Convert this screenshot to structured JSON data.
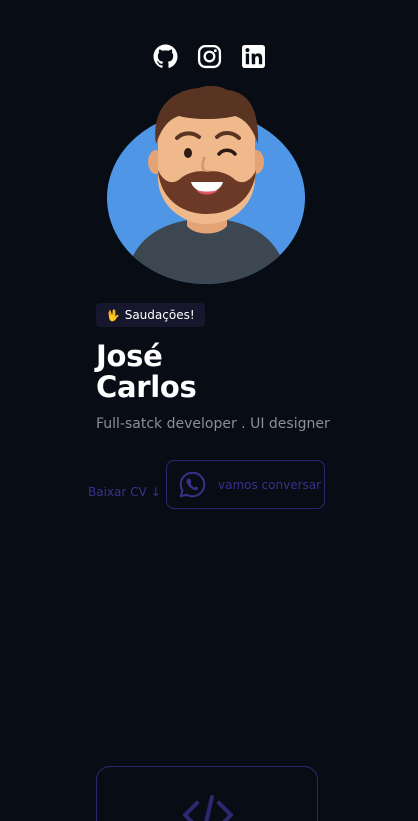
{
  "social": {
    "items": [
      {
        "name": "github",
        "icon": "github-icon"
      },
      {
        "name": "instagram",
        "icon": "instagram-icon"
      },
      {
        "name": "linkedin",
        "icon": "linkedin-icon"
      }
    ]
  },
  "profile": {
    "avatar_icon": "memoji-avatar",
    "greeting": "Saudações!",
    "greeting_icon": "waving-hand-icon",
    "first_name": "José",
    "last_name": "Carlos",
    "role": "Full-satck developer . UI designer"
  },
  "actions": {
    "cv_label": "Baixar CV",
    "cv_icon": "arrow-down-icon",
    "chat_label": "vamos conversar",
    "chat_icon": "whatsapp-icon"
  },
  "card": {
    "icon": "code-icon"
  },
  "colors": {
    "background": "#080d15",
    "accent": "#3b2f8c",
    "accent_border": "#2e2770",
    "badge_bg": "#16172c",
    "muted_text": "#8a8f99",
    "avatar_bg": "#4f96e6"
  }
}
